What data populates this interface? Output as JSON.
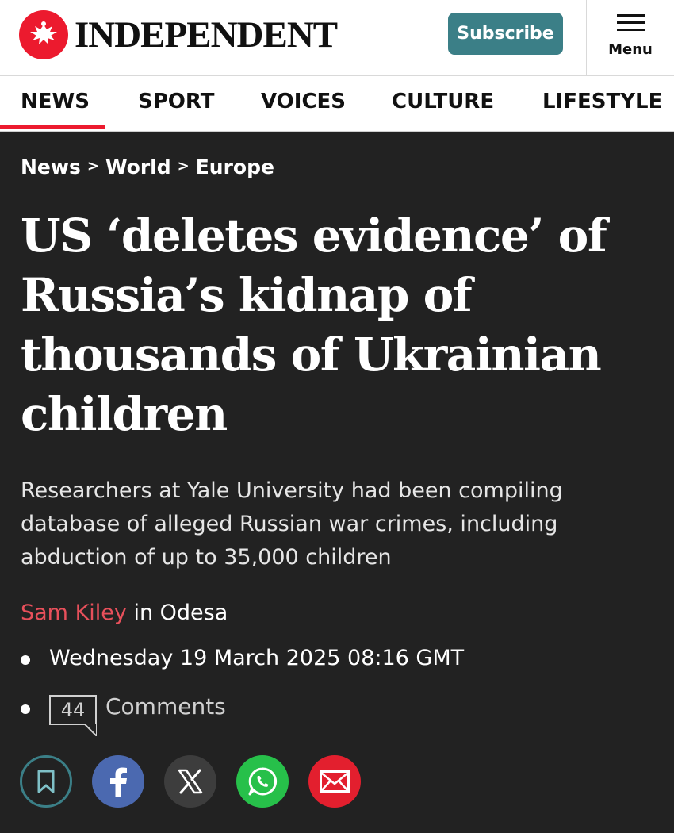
{
  "header": {
    "logo_text": "INDEPENDENT",
    "logo_icon": "eagle-icon",
    "subscribe_label": "Subscribe",
    "menu_label": "Menu"
  },
  "nav": {
    "items": [
      "NEWS",
      "SPORT",
      "VOICES",
      "CULTURE",
      "LIFESTYLE"
    ],
    "active": "NEWS"
  },
  "article": {
    "breadcrumb": [
      "News",
      "World",
      "Europe"
    ],
    "breadcrumb_separator": ">",
    "headline": "US ‘deletes evidence’ of Russia’s kidnap of thousands of Ukrainian children",
    "standfirst": "Researchers at Yale University had been compiling database of alleged Russian war crimes, including abduction of up to 35,000 children",
    "author": "Sam Kiley",
    "location": "in Odesa",
    "date": "Wednesday 19 March 2025 08:16 GMT",
    "comments_count": "44",
    "comments_label": "Comments"
  },
  "share": {
    "buttons": [
      "bookmark-icon",
      "facebook-icon",
      "x-icon",
      "whatsapp-icon",
      "email-icon"
    ]
  },
  "colors": {
    "brand_red": "#ec1a2e",
    "subscribe_teal": "#3b7f87",
    "background_dark": "#222222",
    "author_link": "#e8505b",
    "facebook": "#4b69b0",
    "whatsapp": "#27c04a",
    "email": "#e31f2e"
  }
}
